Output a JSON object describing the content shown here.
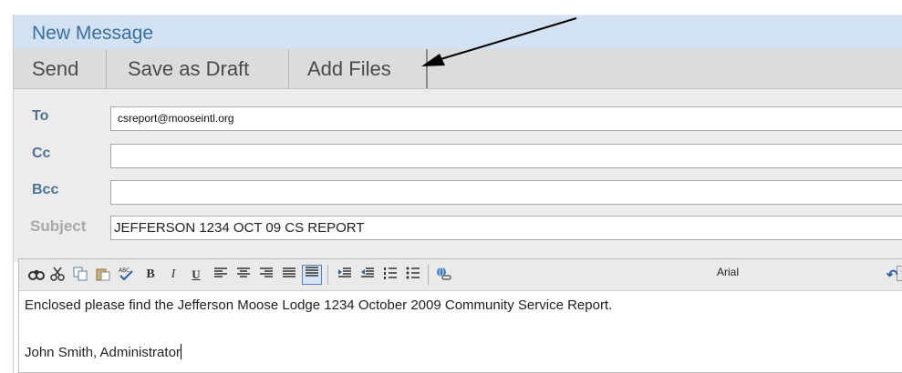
{
  "window": {
    "title": "New Message"
  },
  "toolbar": {
    "send_label": "Send",
    "save_draft_label": "Save as Draft",
    "add_files_label": "Add Files"
  },
  "fields": {
    "to": {
      "label": "To",
      "value": "csreport@mooseintl.org"
    },
    "cc": {
      "label": "Cc",
      "value": ""
    },
    "bcc": {
      "label": "Bcc",
      "value": ""
    },
    "subject": {
      "label": "Subject",
      "value": "JEFFERSON 1234 OCT 09 CS REPORT"
    }
  },
  "editor": {
    "toolbar": {
      "icons": [
        "find-icon",
        "cut-icon",
        "copy-icon",
        "paste-icon",
        "spellcheck-icon",
        "bold-icon",
        "italic-icon",
        "underline-icon",
        "align-left-icon",
        "align-center-icon",
        "align-right-icon",
        "justify-icon",
        "justify-full-icon",
        "outdent-icon",
        "indent-icon",
        "numbered-list-icon",
        "bulleted-list-icon",
        "link-icon",
        "undo-icon"
      ],
      "bold_glyph": "B",
      "italic_glyph": "I",
      "underline_glyph": "U",
      "font_family_value": "Arial"
    },
    "body": {
      "line1": "Enclosed please find the Jefferson Moose Lodge 1234 October 2009 Community Service Report.",
      "line2": "John Smith, Administrator"
    }
  },
  "colors": {
    "title_bar": "#d2e2f2",
    "title_text": "#3a6f9e",
    "toolbar_bg": "#dcdcdc",
    "field_label": "#4a7396",
    "fields_bg": "#ececec"
  }
}
